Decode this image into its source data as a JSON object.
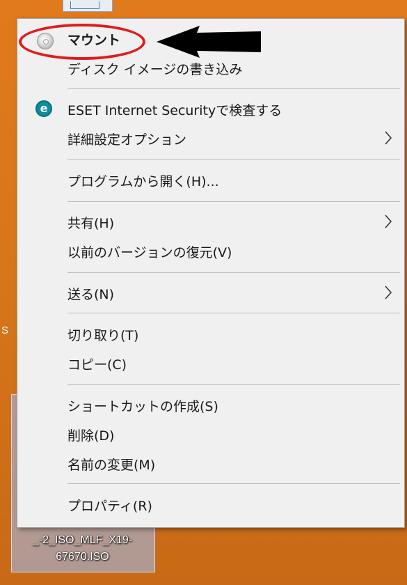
{
  "desktop": {
    "side_char": "S",
    "iso_label_line1": "_-2_ISO_MLF_X19-",
    "iso_label_line2": "67670.ISO"
  },
  "context_menu": {
    "items": [
      {
        "label": "マウント",
        "icon": "disc-icon"
      },
      {
        "label": "ディスク イメージの書き込み"
      },
      {
        "label": "ESET Internet Securityで検査する",
        "icon": "eset-icon"
      },
      {
        "label": "詳細設定オプション",
        "submenu": true
      },
      {
        "label": "プログラムから開く(H)..."
      },
      {
        "label": "共有(H)",
        "submenu": true
      },
      {
        "label": "以前のバージョンの復元(V)"
      },
      {
        "label": "送る(N)",
        "submenu": true
      },
      {
        "label": "切り取り(T)"
      },
      {
        "label": "コピー(C)"
      },
      {
        "label": "ショートカットの作成(S)"
      },
      {
        "label": "削除(D)"
      },
      {
        "label": "名前の変更(M)"
      },
      {
        "label": "プロパティ(R)"
      }
    ],
    "eset_glyph": "e"
  },
  "annotations": {
    "highlight_color": "#e21b1b",
    "arrow_color": "#000000"
  }
}
